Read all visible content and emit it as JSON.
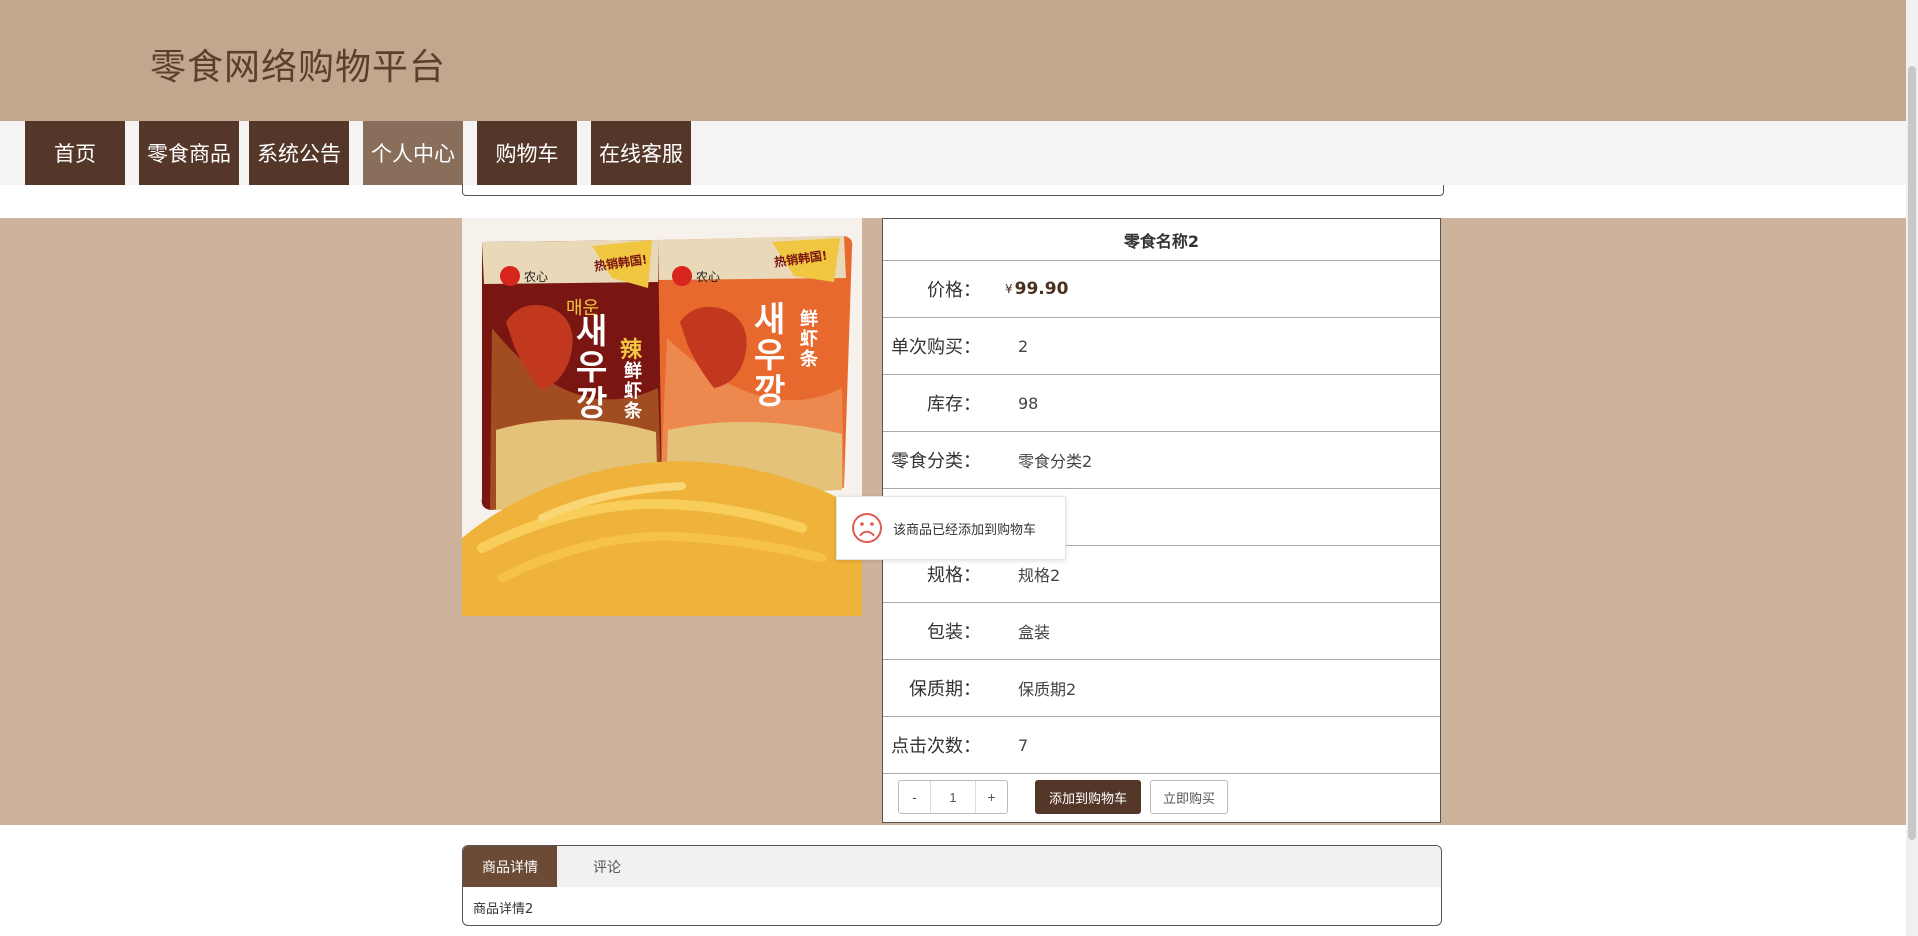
{
  "header": {
    "title": "零食网络购物平台"
  },
  "nav": {
    "items": [
      {
        "label": "首页"
      },
      {
        "label": "零食商品"
      },
      {
        "label": "系统公告"
      },
      {
        "label": "个人中心",
        "active": true
      },
      {
        "label": "购物车"
      },
      {
        "label": "在线客服"
      }
    ]
  },
  "product": {
    "name": "零食名称2",
    "price_symbol": "¥",
    "price": "99.90",
    "rows": [
      {
        "label": "价格："
      },
      {
        "label": "单次购买：",
        "value": "2"
      },
      {
        "label": "库存：",
        "value": "98"
      },
      {
        "label": "零食分类：",
        "value": "零食分类2"
      },
      {
        "label": "",
        "value": ""
      },
      {
        "label": "规格：",
        "value": "规格2"
      },
      {
        "label": "包装：",
        "value": "盒装"
      },
      {
        "label": "保质期：",
        "value": "保质期2"
      },
      {
        "label": "点击次数：",
        "value": "7"
      }
    ],
    "quantity": "1",
    "minus": "-",
    "plus": "+",
    "add_to_cart": "添加到购物车",
    "buy_now": "立即购买"
  },
  "image": {
    "left_pack": {
      "brand": "农心",
      "label_top": "매운",
      "label_korean": "새우깡",
      "label_cn": "鲜虾条",
      "label_spicy": "辣",
      "banner": "热销韩国!"
    },
    "right_pack": {
      "brand": "农心",
      "label_korean": "새우깡",
      "label_cn": "鲜虾条",
      "banner": "热销韩国!"
    }
  },
  "toast": {
    "message": "该商品已经添加到购物车",
    "icon": "sad-face-icon"
  },
  "tabs": {
    "items": [
      {
        "label": "商品详情",
        "active": true
      },
      {
        "label": "评论"
      }
    ],
    "content": "商品详情2"
  },
  "colors": {
    "header_bg": "#c1a78d",
    "band_bg": "#cdb39c",
    "nav_bg": "#55372a",
    "nav_active_bg": "#8a6e5c",
    "accent_dark": "#55372a",
    "toast_icon": "#e05a4f"
  }
}
